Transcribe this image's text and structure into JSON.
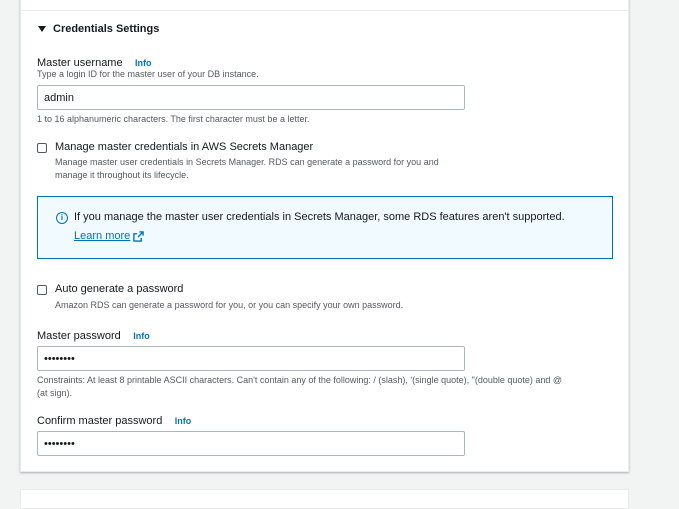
{
  "section": {
    "title": "Credentials Settings"
  },
  "master_username": {
    "label": "Master username",
    "info": "Info",
    "description": "Type a login ID for the master user of your DB instance.",
    "value": "admin",
    "constraint": "1 to 16 alphanumeric characters. The first character must be a letter."
  },
  "secrets_manager": {
    "label": "Manage master credentials in AWS Secrets Manager",
    "description_line1": "Manage master user credentials in Secrets Manager. RDS can generate a password for you and",
    "description_line2": "manage it throughout its lifecycle.",
    "checked": false
  },
  "alert": {
    "text": "If you manage the master user credentials in Secrets Manager, some RDS features aren't supported.",
    "link": "Learn more",
    "icon": "info-circle-icon",
    "link_icon": "external-link-icon"
  },
  "auto_generate": {
    "label": "Auto generate a password",
    "description": "Amazon RDS can generate a password for you, or you can specify your own password.",
    "checked": false
  },
  "master_password": {
    "label": "Master password",
    "info": "Info",
    "value": "••••••••",
    "constraint_line1": "Constraints: At least 8 printable ASCII characters. Can't contain any of the following: / (slash), '(single quote), \"(double quote) and @",
    "constraint_line2": "(at sign)."
  },
  "confirm_password": {
    "label": "Confirm master password",
    "info": "Info",
    "value": "••••••••"
  },
  "colors": {
    "link": "#0073bb",
    "alert_bg": "#f1faff",
    "text": "#16191f",
    "muted": "#545b64"
  }
}
